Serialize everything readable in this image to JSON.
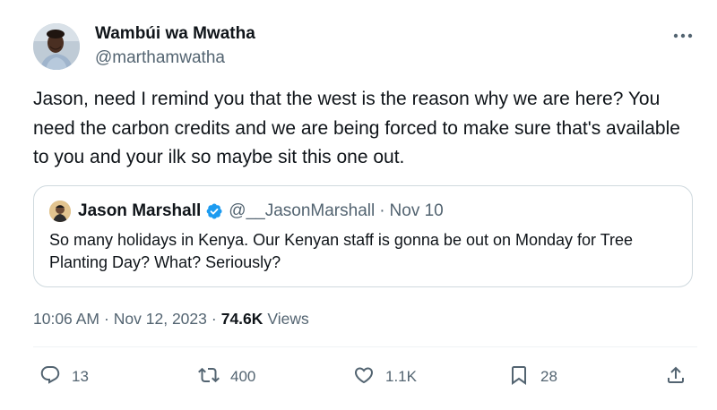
{
  "tweet": {
    "author": {
      "name": "Wambúi wa Mwatha",
      "handle": "@marthamwatha"
    },
    "more_icon": "more-horizontal-icon",
    "text": "Jason, need I remind you that the west is the reason why we are here? You need the carbon credits and we are being forced to make sure that's available to you and your ilk so maybe sit this one out.",
    "quote": {
      "name": "Jason Marshall",
      "verified_icon": "verified-badge-icon",
      "verified_color": "#1d9bf0",
      "handle": "@__JasonMarshall",
      "separator": "·",
      "date": "Nov 10",
      "text": "So many holidays in Kenya. Our Kenyan staff is gonna be out on Monday for Tree Planting Day? What? Seriously?"
    },
    "meta": {
      "time": "10:06 AM",
      "separator1": "·",
      "date": "Nov 12, 2023",
      "separator2": "·",
      "views_count": "74.6K",
      "views_label": "Views"
    },
    "actions": {
      "reply": {
        "icon": "reply-icon",
        "count": "13"
      },
      "retweet": {
        "icon": "retweet-icon",
        "count": "400"
      },
      "like": {
        "icon": "heart-icon",
        "count": "1.1K"
      },
      "bookmark": {
        "icon": "bookmark-icon",
        "count": "28"
      },
      "share": {
        "icon": "share-icon"
      }
    }
  },
  "colors": {
    "text_primary": "#0f1419",
    "text_secondary": "#536471",
    "border": "#cfd9de",
    "verified": "#1d9bf0"
  }
}
